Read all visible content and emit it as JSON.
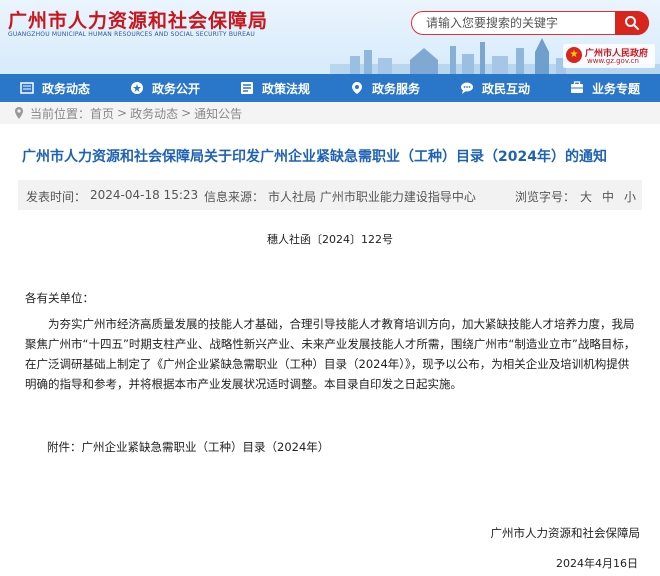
{
  "header": {
    "title": "广州市人力资源和社会保障局",
    "subtitle": "GUANGZHOU MUNICIPAL HUMAN RESOURCES AND SOCIAL SECURITY BUREAU",
    "search_placeholder": "请输入您要搜索的关键字",
    "gov_badge_name": "广州市人民政府",
    "gov_badge_url": "www.gz.gov.cn"
  },
  "nav": [
    {
      "label": "政务动态",
      "icon": "news-icon"
    },
    {
      "label": "政务公开",
      "icon": "open-gov-icon"
    },
    {
      "label": "政策法规",
      "icon": "policy-icon"
    },
    {
      "label": "政务服务",
      "icon": "service-icon"
    },
    {
      "label": "政民互动",
      "icon": "chat-icon"
    },
    {
      "label": "业务专题",
      "icon": "topics-icon"
    }
  ],
  "breadcrumb": {
    "prefix": "当前位置：",
    "items": [
      "首页",
      "政务动态",
      "通知公告"
    ],
    "separator": ">"
  },
  "article": {
    "title": "广州市人力资源和社会保障局关于印发广州企业紧缺急需职业（工种）目录（2024年）的通知",
    "publish_label": "发表时间：",
    "publish_time": "2024-04-18 15:23",
    "source_label": "信息来源：",
    "source": "市人社局 广州市职业能力建设指导中心",
    "font_size_label": "浏览字号：",
    "font_sizes": [
      "大",
      "中",
      "小"
    ],
    "doc_number": "穗人社函〔2024〕122号",
    "salutation": "各有关单位：",
    "body": "为夯实广州市经济高质量发展的技能人才基础，合理引导技能人才教育培训方向，加大紧缺技能人才培养力度，我局聚焦广州市“十四五”时期支柱产业、战略性新兴产业、未来产业发展技能人才所需，围绕广州市“制造业立市”战略目标，在广泛调研基础上制定了《广州企业紧缺急需职业（工种）目录（2024年）》，现予以公布，为相关企业及培训机构提供明确的指导和参考，并将根据本市产业发展状况适时调整。本目录自印发之日起实施。",
    "attachment": "附件：广州企业紧缺急需职业（工种）目录（2024年）",
    "signatory": "广州市人力资源和社会保障局",
    "date": "2024年4月16日"
  },
  "colors": {
    "brand_red": "#c8161d",
    "nav_blue": "#2a76c9",
    "title_blue": "#1f62b4"
  }
}
